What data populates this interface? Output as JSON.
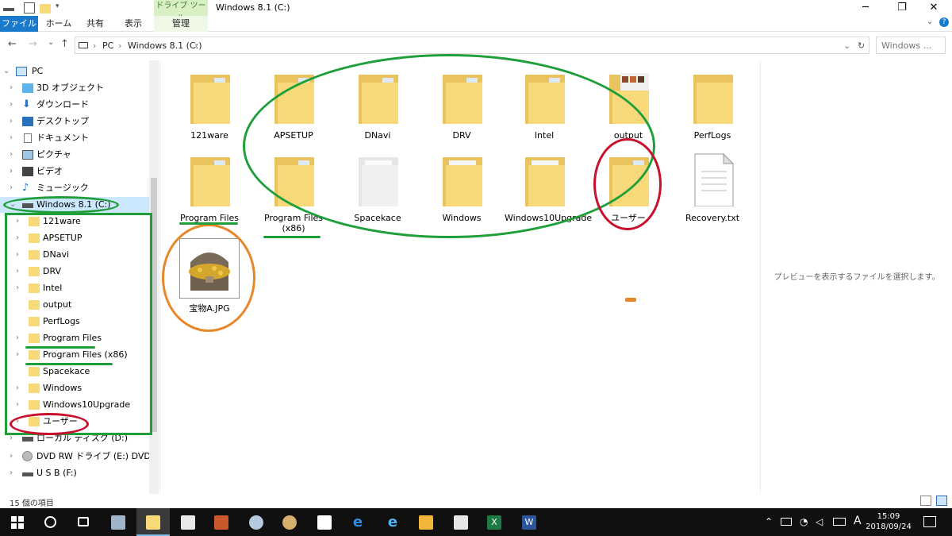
{
  "titlebar": {
    "window_title": "Windows 8.1 (C:)",
    "context_tab_label": "ドライブ ツール",
    "minimize": "─",
    "maximize": "❐",
    "close": "✕"
  },
  "ribbon": {
    "tabs": [
      {
        "label": "ファイル"
      },
      {
        "label": "ホーム"
      },
      {
        "label": "共有"
      },
      {
        "label": "表示"
      },
      {
        "label": "管理"
      }
    ]
  },
  "address": {
    "back": "←",
    "forward": "→",
    "recent": "⌄",
    "up": "↑",
    "crumbs": [
      "PC",
      "Windows 8.1 (C:)"
    ],
    "separator": "›",
    "refresh": "↻",
    "search_placeholder": "Windows ..."
  },
  "navpane": {
    "items": [
      {
        "label": "PC",
        "icon": "pc-icon"
      },
      {
        "label": "3D オブジェクト",
        "icon": "3d-objects-icon"
      },
      {
        "label": "ダウンロード",
        "icon": "download-icon"
      },
      {
        "label": "デスクトップ",
        "icon": "desktop-icon"
      },
      {
        "label": "ドキュメント",
        "icon": "documents-icon"
      },
      {
        "label": "ピクチャ",
        "icon": "pictures-icon"
      },
      {
        "label": "ビデオ",
        "icon": "video-icon"
      },
      {
        "label": "ミュージック",
        "icon": "music-icon"
      },
      {
        "label": "Windows 8.1 (C:)",
        "icon": "drive-icon"
      },
      {
        "label": "121ware"
      },
      {
        "label": "APSETUP"
      },
      {
        "label": "DNavi"
      },
      {
        "label": "DRV"
      },
      {
        "label": "Intel"
      },
      {
        "label": "output"
      },
      {
        "label": "PerfLogs"
      },
      {
        "label": "Program Files"
      },
      {
        "label": "Program Files (x86)"
      },
      {
        "label": "Spacekace"
      },
      {
        "label": "Windows"
      },
      {
        "label": "Windows10Upgrade"
      },
      {
        "label": "ユーザー"
      },
      {
        "label": "ローカル ディスク (D:)",
        "icon": "drive-icon"
      },
      {
        "label": "DVD RW ドライブ (E:) DVD",
        "icon": "dvd-icon"
      },
      {
        "label": "U S B (F:)",
        "icon": "usb-icon"
      }
    ]
  },
  "content": {
    "items": [
      {
        "label": "121ware"
      },
      {
        "label": "APSETUP"
      },
      {
        "label": "DNavi"
      },
      {
        "label": "DRV"
      },
      {
        "label": "Intel"
      },
      {
        "label": "output"
      },
      {
        "label": "PerfLogs"
      },
      {
        "label": "Program Files"
      },
      {
        "label": "Program Files (x86)"
      },
      {
        "label": "Spacekace"
      },
      {
        "label": "Windows"
      },
      {
        "label": "Windows10Upgrade"
      },
      {
        "label": "ユーザー"
      },
      {
        "label": "Recovery.txt"
      },
      {
        "label": "宝物A.JPG"
      }
    ]
  },
  "preview": {
    "message": "プレビューを表示するファイルを選択します。"
  },
  "status": {
    "item_count": "15 個の項目"
  },
  "taskbar": {
    "time": "15:09",
    "date": "2018/09/24",
    "ime": "A"
  },
  "colors": {
    "accent": "#1979ca",
    "folder": "#f7d97a",
    "annotation_green": "#1f9e3a",
    "annotation_red": "#c8102e",
    "annotation_orange": "#e8872a"
  }
}
